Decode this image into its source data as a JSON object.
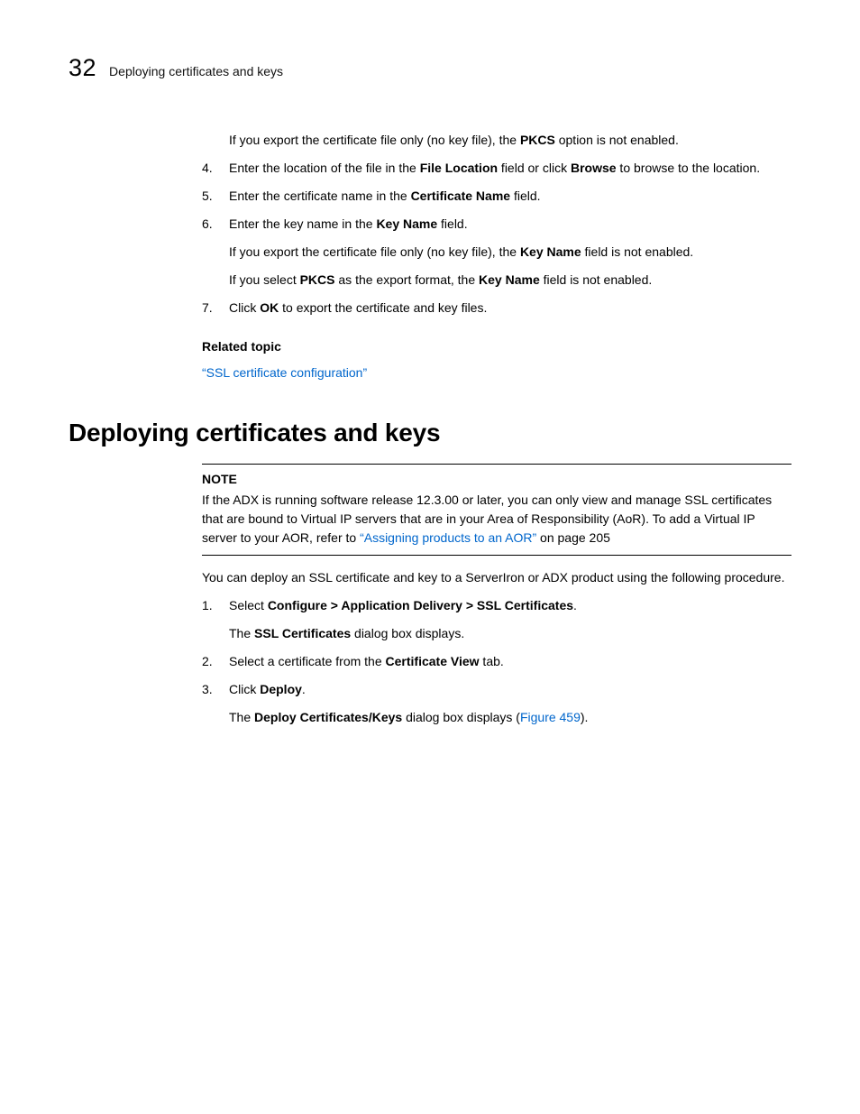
{
  "header": {
    "chapter_number": "32",
    "running_title": "Deploying certificates and keys"
  },
  "intro": {
    "p1_a": "If you export the certificate file only (no key file), the ",
    "p1_b": "PKCS",
    "p1_c": " option is not enabled."
  },
  "steps_a": {
    "i4": {
      "num": "4.",
      "a": "Enter the location of the file in the ",
      "b": "File Location",
      "c": " field or click ",
      "d": "Browse",
      "e": " to browse to the location."
    },
    "i5": {
      "num": "5.",
      "a": "Enter the certificate name in the ",
      "b": "Certificate Name",
      "c": " field."
    },
    "i6": {
      "num": "6.",
      "a": "Enter the key name in the ",
      "b": "Key Name",
      "c": " field.",
      "sub1_a": "If you export the certificate file only (no key file), the ",
      "sub1_b": "Key Name",
      "sub1_c": " field is not enabled.",
      "sub2_a": "If you select ",
      "sub2_b": "PKCS",
      "sub2_c": " as the export format, the ",
      "sub2_d": "Key Name",
      "sub2_e": " field is not enabled."
    },
    "i7": {
      "num": "7.",
      "a": "Click ",
      "b": "OK",
      "c": " to export the certificate and key files."
    }
  },
  "related": {
    "heading": "Related topic",
    "link_text": "“SSL certificate configuration”"
  },
  "section": {
    "heading": "Deploying certificates and keys"
  },
  "note": {
    "label": "NOTE",
    "body_a": "If the ADX is running software release 12.3.00 or later, you can only view and manage SSL certificates that are bound to Virtual IP servers that are in your Area of Responsibility (AoR). To add a Virtual IP server to your AOR, refer to ",
    "link": "“Assigning products to an AOR”",
    "body_b": " on page 205"
  },
  "after_note": {
    "p": "You can deploy an SSL certificate and key to a ServerIron or ADX product using the following procedure."
  },
  "steps_b": {
    "i1": {
      "num": "1.",
      "a": "Select ",
      "b": "Configure > Application Delivery > SSL Certificates",
      "c": ".",
      "sub_a": "The ",
      "sub_b": "SSL Certificates",
      "sub_c": " dialog box displays."
    },
    "i2": {
      "num": "2.",
      "a": "Select a certificate from the ",
      "b": "Certificate View",
      "c": " tab."
    },
    "i3": {
      "num": "3.",
      "a": "Click ",
      "b": "Deploy",
      "c": ".",
      "sub_a": "The ",
      "sub_b": "Deploy Certificates/Keys",
      "sub_c": " dialog box displays (",
      "sub_link": "Figure 459",
      "sub_d": ")."
    }
  }
}
